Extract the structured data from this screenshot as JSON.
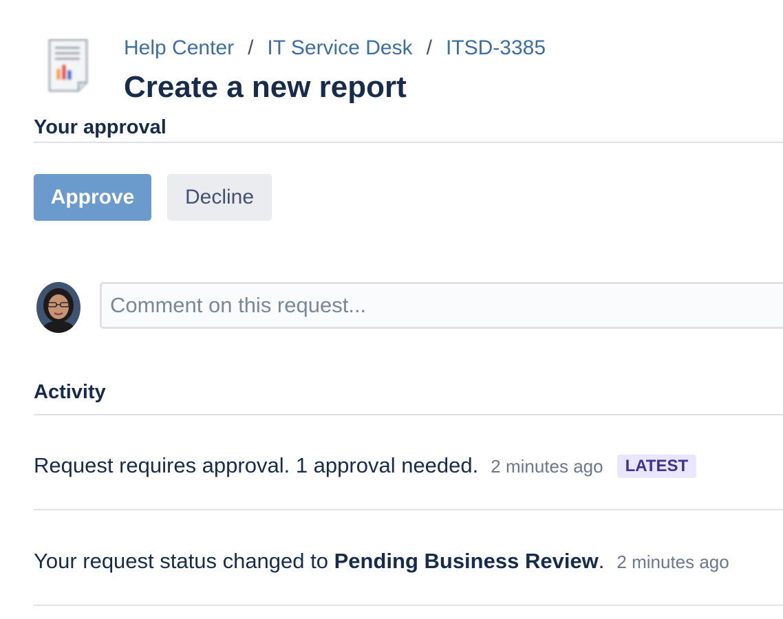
{
  "header": {
    "breadcrumbs": [
      "Help Center",
      "IT Service Desk",
      "ITSD-3385"
    ],
    "separator": "/",
    "title": "Create a new report"
  },
  "approval": {
    "heading": "Your approval",
    "approve_label": "Approve",
    "decline_label": "Decline"
  },
  "comment": {
    "placeholder": "Comment on this request..."
  },
  "activity": {
    "heading": "Activity",
    "items": [
      {
        "text": "Request requires approval. 1 approval needed.",
        "time": "2 minutes ago",
        "badge": "LATEST"
      },
      {
        "text_prefix": "Your request status changed to ",
        "status": "Pending Business Review",
        "text_suffix": ".",
        "time": "2 minutes ago"
      }
    ]
  },
  "colors": {
    "link": "#3b6ea5",
    "approve_bg": "#6b9bcc",
    "decline_bg": "#ebecf0",
    "badge_bg": "#eae6ff",
    "badge_text": "#403294"
  },
  "icons": {
    "request_type": "report-document-icon",
    "user": "user-avatar"
  }
}
